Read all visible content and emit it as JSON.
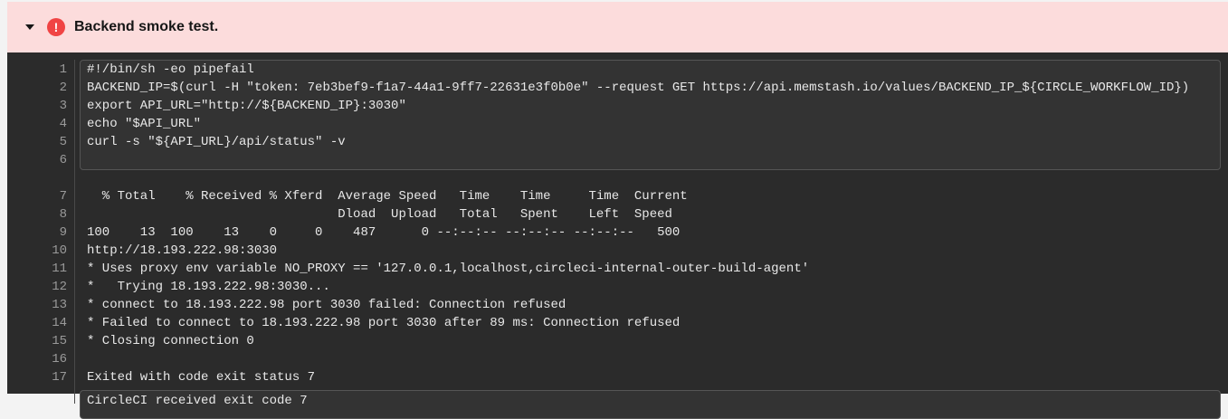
{
  "step": {
    "title": "Backend smoke test.",
    "status": "failed",
    "status_color": "#f04444",
    "icon": "error-icon"
  },
  "script_lines": [
    {
      "n": "1",
      "t": "#!/bin/sh -eo pipefail"
    },
    {
      "n": "2",
      "t": "BACKEND_IP=$(curl -H \"token: 7eb3bef9-f1a7-44a1-9ff7-22631e3f0b0e\" --request GET https://api.memstash.io/values/BACKEND_IP_${CIRCLE_WORKFLOW_ID})"
    },
    {
      "n": "3",
      "t": "export API_URL=\"http://${BACKEND_IP}:3030\""
    },
    {
      "n": "4",
      "t": "echo \"$API_URL\""
    },
    {
      "n": "5",
      "t": "curl -s \"${API_URL}/api/status\" -v"
    },
    {
      "n": "6",
      "t": ""
    }
  ],
  "output_lines": [
    {
      "n": "7",
      "t": "  % Total    % Received % Xferd  Average Speed   Time    Time     Time  Current"
    },
    {
      "n": "8",
      "t": "                                 Dload  Upload   Total   Spent    Left  Speed"
    },
    {
      "n": "9",
      "t": "100    13  100    13    0     0    487      0 --:--:-- --:--:-- --:--:--   500"
    },
    {
      "n": "10",
      "t": "http://18.193.222.98:3030"
    },
    {
      "n": "11",
      "t": "* Uses proxy env variable NO_PROXY == '127.0.0.1,localhost,circleci-internal-outer-build-agent'"
    },
    {
      "n": "12",
      "t": "*   Trying 18.193.222.98:3030..."
    },
    {
      "n": "13",
      "t": "* connect to 18.193.222.98 port 3030 failed: Connection refused"
    },
    {
      "n": "14",
      "t": "* Failed to connect to 18.193.222.98 port 3030 after 89 ms: Connection refused"
    },
    {
      "n": "15",
      "t": "* Closing connection 0"
    },
    {
      "n": "16",
      "t": ""
    },
    {
      "n": "17",
      "t": "Exited with code exit status 7"
    }
  ],
  "footer_line": "CircleCI received exit code 7"
}
